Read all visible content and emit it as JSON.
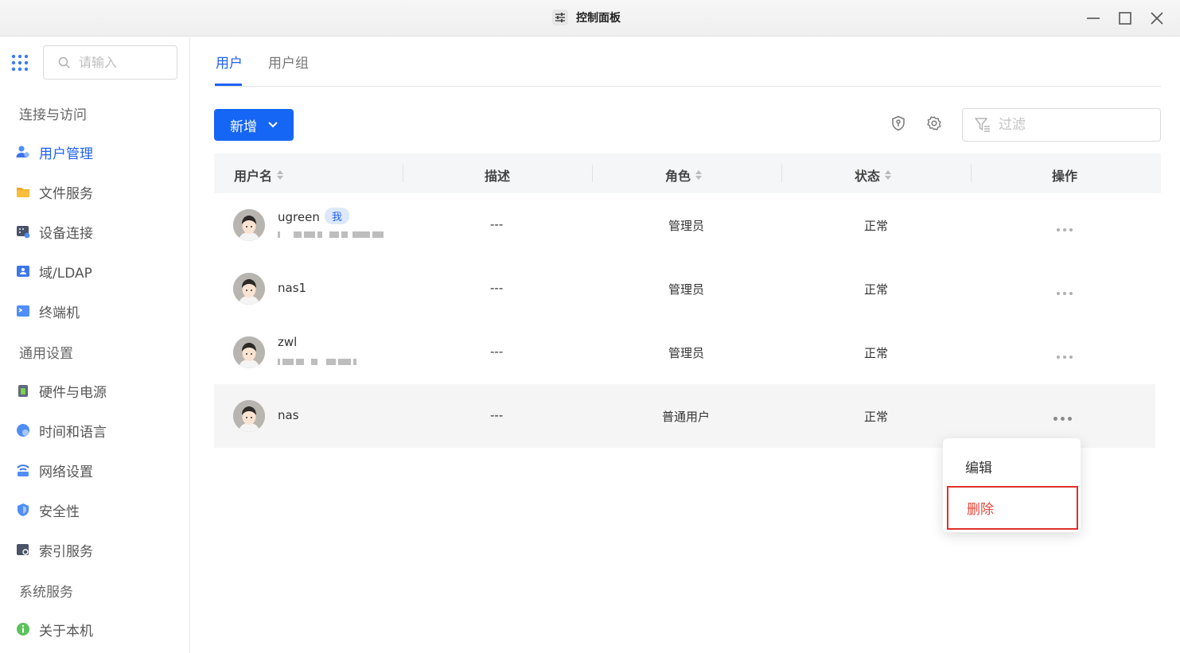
{
  "window": {
    "title": "控制面板",
    "controls": [
      "minimize",
      "maximize",
      "close"
    ]
  },
  "sidebar": {
    "search_placeholder": "请输入",
    "sections": [
      {
        "label": "连接与访问"
      },
      {
        "label": "通用设置"
      },
      {
        "label": "系统服务"
      }
    ],
    "items": [
      {
        "label": "用户管理",
        "icon": "users-icon",
        "active": true
      },
      {
        "label": "文件服务",
        "icon": "folder-icon"
      },
      {
        "label": "设备连接",
        "icon": "device-icon"
      },
      {
        "label": "域/LDAP",
        "icon": "domain-icon"
      },
      {
        "label": "终端机",
        "icon": "terminal-icon"
      },
      {
        "label": "硬件与电源",
        "icon": "hardware-icon"
      },
      {
        "label": "时间和语言",
        "icon": "clock-icon"
      },
      {
        "label": "网络设置",
        "icon": "network-icon"
      },
      {
        "label": "安全性",
        "icon": "shield-icon"
      },
      {
        "label": "索引服务",
        "icon": "index-icon"
      },
      {
        "label": "关于本机",
        "icon": "info-icon"
      }
    ]
  },
  "tabs": [
    {
      "label": "用户",
      "active": true
    },
    {
      "label": "用户组"
    }
  ],
  "toolbar": {
    "add_label": "新增",
    "filter_placeholder": "过滤"
  },
  "table": {
    "columns": [
      "用户名",
      "描述",
      "角色",
      "状态",
      "操作"
    ],
    "rows": [
      {
        "name": "ugreen",
        "badge": "我",
        "description": "---",
        "role": "管理员",
        "status": "正常",
        "has_email": true
      },
      {
        "name": "nas1",
        "description": "---",
        "role": "管理员",
        "status": "正常"
      },
      {
        "name": "zwl",
        "description": "---",
        "role": "管理员",
        "status": "正常",
        "has_email": true
      },
      {
        "name": "nas",
        "description": "---",
        "role": "普通用户",
        "status": "正常"
      }
    ]
  },
  "context_menu": {
    "items": [
      {
        "label": "编辑"
      },
      {
        "label": "删除",
        "highlighted": true
      }
    ]
  },
  "colors": {
    "accent": "#1666f5",
    "danger": "#e8473a"
  }
}
